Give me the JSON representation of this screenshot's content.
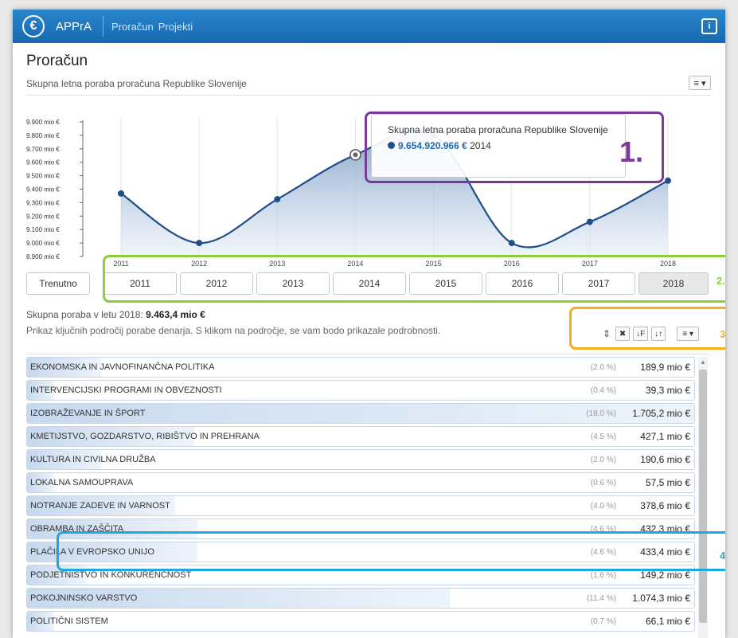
{
  "navbar": {
    "logo": "€",
    "app_name": "APPrA",
    "links": [
      "Proračun",
      "Projekti"
    ],
    "info_icon": "i"
  },
  "page": {
    "title": "Proračun",
    "subtitle": "Skupna letna poraba proračuna Republike Slovenije",
    "menu_glyph": "≡ ▾"
  },
  "chart_data": {
    "type": "area",
    "x": [
      "2011",
      "2012",
      "2013",
      "2014",
      "2015",
      "2016",
      "2017",
      "2018"
    ],
    "series": [
      {
        "values": [
          9368,
          9000,
          9325,
          9654.9,
          9802,
          9000,
          9157,
          9463.4
        ]
      }
    ],
    "y_ticks": [
      "9.900 mio €",
      "9.800 mio €",
      "9.700 mio €",
      "9.600 mio €",
      "9.500 mio €",
      "9.400 mio €",
      "9.300 mio €",
      "9.200 mio €",
      "9.100 mio €",
      "9.000 mio €",
      "8.900 mio €"
    ],
    "ylim": [
      8900,
      9900
    ],
    "grid": "vertical",
    "color": "#1e4f8a"
  },
  "tooltip": {
    "title": "Skupna letna poraba proračuna Republike Slovenije",
    "value": "9.654.920.966 €",
    "year": "2014"
  },
  "annotations": [
    "1.",
    "2.",
    "3.",
    "4."
  ],
  "year_buttons": [
    "Trenutno",
    "2011",
    "2012",
    "2013",
    "2014",
    "2015",
    "2016",
    "2017",
    "2018"
  ],
  "selected_year": "2018",
  "summary": {
    "total_label": "Skupna poraba v letu 2018:",
    "total_value": "9.463,4 mio €",
    "description": "Prikaz ključnih področij porabe denarja. S klikom na področje, se vam bodo prikazale podrobnosti."
  },
  "tools": {
    "sort_icon": "⇕",
    "clear": "✖",
    "sort_desc": "↓F",
    "sort_asc": "↓↑",
    "menu": "≡ ▾"
  },
  "rows": [
    {
      "label": "EKONOMSKA IN JAVNOFINANČNA POLITIKA",
      "pct": "(2.0 %)",
      "value": "189,9 mio €",
      "share": 0.02
    },
    {
      "label": "INTERVENCIJSKI PROGRAMI IN OBVEZNOSTI",
      "pct": "(0.4 %)",
      "value": "39,3 mio €",
      "share": 0.004
    },
    {
      "label": "IZOBRAŽEVANJE IN ŠPORT",
      "pct": "(18.0 %)",
      "value": "1.705,2 mio €",
      "share": 0.18
    },
    {
      "label": "KMETIJSTVO, GOZDARSTVO, RIBIŠTVO IN PREHRANA",
      "pct": "(4.5 %)",
      "value": "427,1 mio €",
      "share": 0.045
    },
    {
      "label": "KULTURA IN CIVILNA DRUŽBA",
      "pct": "(2.0 %)",
      "value": "190,6 mio €",
      "share": 0.02
    },
    {
      "label": "LOKALNA SAMOUPRAVA",
      "pct": "(0.6 %)",
      "value": "57,5 mio €",
      "share": 0.006
    },
    {
      "label": "NOTRANJE ZADEVE IN VARNOST",
      "pct": "(4.0 %)",
      "value": "378,6 mio €",
      "share": 0.04
    },
    {
      "label": "OBRAMBA IN ZAŠČITA",
      "pct": "(4.6 %)",
      "value": "432,3 mio €",
      "share": 0.046
    },
    {
      "label": "PLAČILA V EVROPSKO UNIJO",
      "pct": "(4.6 %)",
      "value": "433,4 mio €",
      "share": 0.046
    },
    {
      "label": "PODJETNIŠTVO IN KONKURENČNOST",
      "pct": "(1.6 %)",
      "value": "149,2 mio €",
      "share": 0.016
    },
    {
      "label": "POKOJNINSKO VARSTVO",
      "pct": "(11.4 %)",
      "value": "1.074,3 mio €",
      "share": 0.114
    },
    {
      "label": "POLITIČNI SISTEM",
      "pct": "(0.7 %)",
      "value": "66,1 mio €",
      "share": 0.007
    }
  ]
}
